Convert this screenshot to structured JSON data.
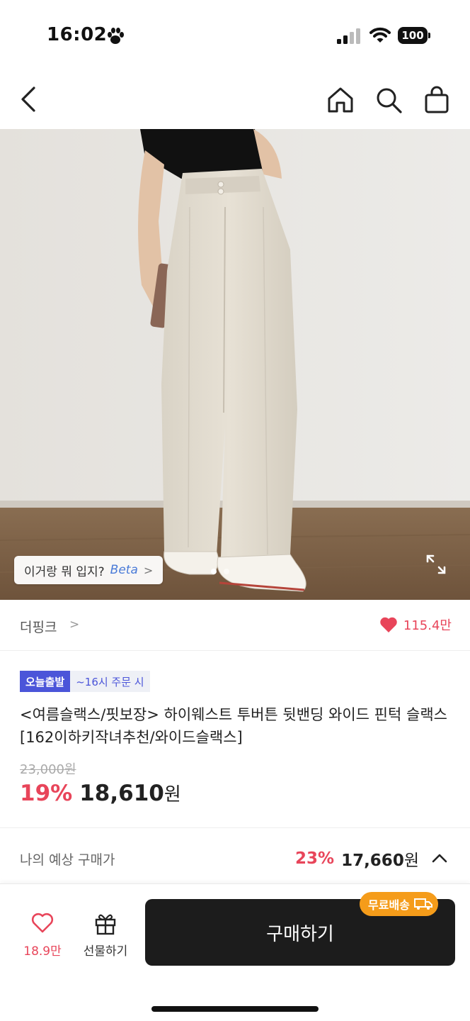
{
  "status_bar": {
    "time": "16:02",
    "battery": "100"
  },
  "nav": {
    "icons": [
      "back-icon",
      "home-icon",
      "search-icon",
      "bag-icon"
    ]
  },
  "gallery": {
    "style_chip": {
      "label": "이거랑 뭐 입지?",
      "beta": "Beta",
      "chevron": ">"
    },
    "dots": 2
  },
  "brand": {
    "name": "더핑크",
    "chevron": ">",
    "likes": "115.4만"
  },
  "badges": {
    "today": "오늘출발",
    "deadline": "~16시 주문 시"
  },
  "product": {
    "title": "<여름슬랙스/핏보장> 하이웨스트 투버튼 뒷밴딩 와이드 핀턱 슬랙스 [162이하키작녀추천/와이드슬랙스]",
    "original_price": "23,000원",
    "discount": "19%",
    "price": "18,610",
    "price_unit": "원"
  },
  "expected": {
    "label": "나의 예상 구매가",
    "discount": "23%",
    "price": "17,660",
    "price_unit": "원"
  },
  "bottom_bar": {
    "wish_count": "18.9만",
    "gift_label": "선물하기",
    "buy_label": "구매하기",
    "free_shipping": "무료배송"
  },
  "colors": {
    "accent": "#e8455a",
    "badge_blue": "#4b55d9",
    "ship_orange": "#f59c1a",
    "buy_bg": "#1c1c1c"
  }
}
